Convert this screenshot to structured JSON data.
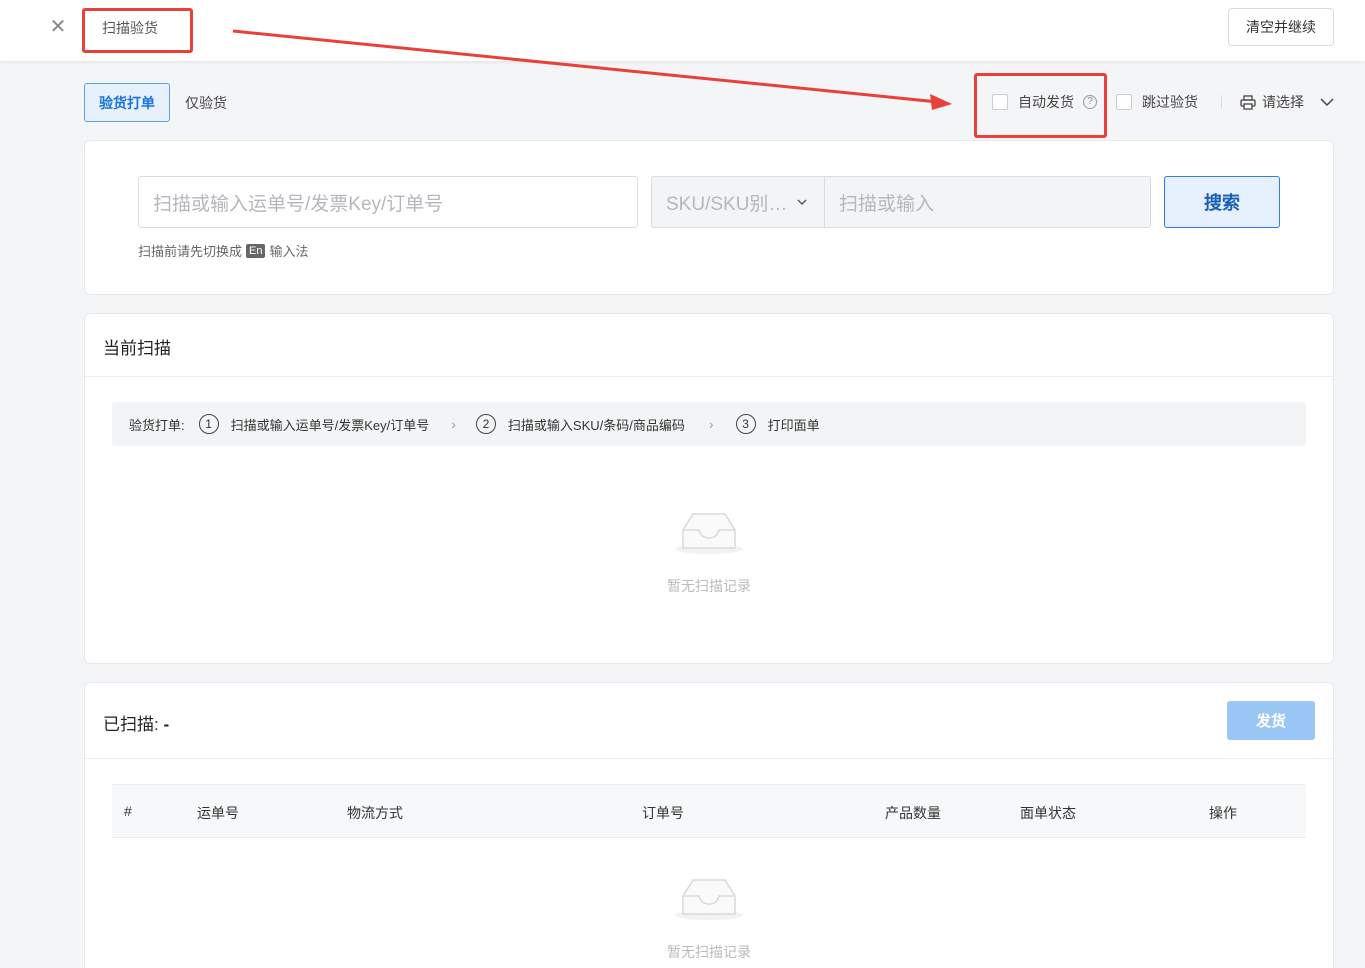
{
  "header": {
    "title": "扫描验货",
    "clear_button": "清空并继续"
  },
  "mode_tabs": [
    {
      "label": "验货打单",
      "active": true
    },
    {
      "label": "仅验货",
      "active": false
    }
  ],
  "options": {
    "auto_ship": "自动发货",
    "help": "?",
    "skip_inspect": "跳过验货",
    "printer_select": "请选择"
  },
  "search": {
    "order_placeholder": "扫描或输入运单号/发票Key/订单号",
    "sku_type_selected": "SKU/SKU别…",
    "sku_placeholder": "扫描或输入",
    "search_button": "搜索",
    "hint_before": "扫描前请先切换成",
    "hint_badge": "En",
    "hint_after": "输入法"
  },
  "current_scan": {
    "title": "当前扫描",
    "steps_label": "验货打单:",
    "steps": [
      {
        "num": "1",
        "text": "扫描或输入运单号/发票Key/订单号"
      },
      {
        "num": "2",
        "text": "扫描或输入SKU/条码/商品编码"
      },
      {
        "num": "3",
        "text": "打印面单"
      }
    ],
    "empty_text": "暂无扫描记录"
  },
  "scanned": {
    "title": "已扫描:",
    "count": "-",
    "ship_button": "发货",
    "columns": [
      "#",
      "运单号",
      "物流方式",
      "订单号",
      "产品数量",
      "面单状态",
      "操作"
    ],
    "empty_text": "暂无扫描记录"
  },
  "colors": {
    "accent": "#2f7ee0",
    "annotation_red": "#e8413a",
    "disabled_button": "#9ac6f6"
  }
}
